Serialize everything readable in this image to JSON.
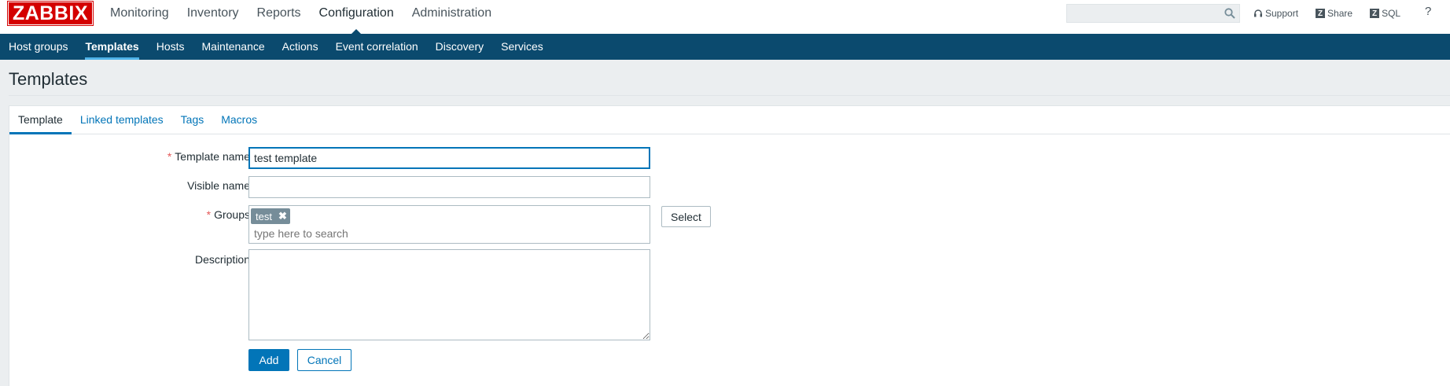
{
  "brand": {
    "logo_text": "ZABBIX",
    "color": "#d40000"
  },
  "main_menu": {
    "items": [
      "Monitoring",
      "Inventory",
      "Reports",
      "Configuration",
      "Administration"
    ],
    "active": "Configuration"
  },
  "header": {
    "search": {
      "value": "",
      "placeholder": "",
      "icon": "search-icon"
    },
    "support_label": "Support",
    "share_label": "Share",
    "sql_label": "SQL",
    "help_label": "?"
  },
  "sub_menu": {
    "items": [
      "Host groups",
      "Templates",
      "Hosts",
      "Maintenance",
      "Actions",
      "Event correlation",
      "Discovery",
      "Services"
    ],
    "active": "Templates",
    "background": "#0b4a6e"
  },
  "page": {
    "title": "Templates"
  },
  "tabs": {
    "items": [
      "Template",
      "Linked templates",
      "Tags",
      "Macros"
    ],
    "active": "Template"
  },
  "form": {
    "template_name": {
      "label": "Template name",
      "required": "*",
      "value": "test template"
    },
    "visible_name": {
      "label": "Visible name",
      "value": ""
    },
    "groups": {
      "label": "Groups",
      "required": "*",
      "selected": [
        "test"
      ],
      "placeholder": "type here to search",
      "select_button": "Select"
    },
    "description": {
      "label": "Description",
      "value": ""
    },
    "add_button": "Add",
    "cancel_button": "Cancel"
  },
  "colors": {
    "accent": "#0275b8",
    "required": "#e45959",
    "chip": "#768d99"
  }
}
